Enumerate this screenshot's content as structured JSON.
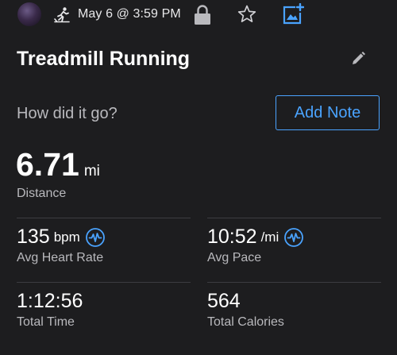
{
  "header": {
    "date_time": "May 6 @ 3:59 PM",
    "accent_color": "#4aa3ff",
    "icons": [
      "avatar",
      "treadmill-run-icon",
      "lock-icon",
      "star-icon",
      "add-photo-icon"
    ]
  },
  "activity": {
    "title": "Treadmill Running",
    "prompt": "How did it go?",
    "add_note_label": "Add Note"
  },
  "distance": {
    "value": "6.71",
    "unit": "mi",
    "label": "Distance"
  },
  "stats": {
    "heart_rate": {
      "value": "135",
      "unit": "bpm",
      "label": "Avg Heart Rate"
    },
    "pace": {
      "value": "10:52",
      "unit": "/mi",
      "label": "Avg Pace"
    },
    "time": {
      "value": "1:12:56",
      "label": "Total Time"
    },
    "calories": {
      "value": "564",
      "label": "Total Calories"
    }
  }
}
